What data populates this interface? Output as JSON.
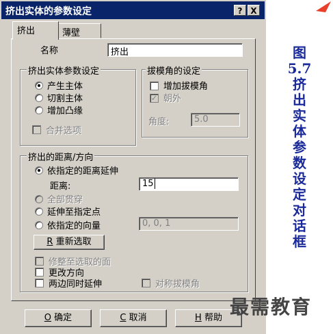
{
  "dialog": {
    "title": "挤出实体的参数设定",
    "help_button": "?",
    "close_button": "X",
    "tabs": [
      {
        "label": "挤出"
      },
      {
        "label": "薄壁"
      }
    ],
    "name_label": "名称",
    "name_value": "挤出",
    "group_params": {
      "title": "挤出实体参数设定",
      "radios": [
        {
          "label": "产生主体",
          "checked": true
        },
        {
          "label": "切割主体",
          "checked": false
        },
        {
          "label": "增加凸缘",
          "checked": false
        }
      ],
      "merge_checkbox": "合并选项"
    },
    "group_draft": {
      "title": "拔模角的设定",
      "add_draft": "增加拔模角",
      "outward": "朝外",
      "angle_label": "角度:",
      "angle_value": "5.0"
    },
    "group_distance": {
      "title": "挤出的距离/方向",
      "by_distance": "依指定的距离延伸",
      "distance_label": "距离:",
      "distance_value": "15",
      "through_all": "全部贯穿",
      "to_point": "延伸至指定点",
      "by_vector": "依指定的向量",
      "vector_value": "0, 0, 1",
      "reselect_key": "R",
      "reselect_label": "重新选取",
      "trim_face": "修整至选取的面",
      "change_direction": "更改方向",
      "both_sides": "两边同时延伸",
      "symmetric_draft": "对称拔模角"
    },
    "buttons": {
      "ok_key": "O",
      "ok_label": "确定",
      "cancel_key": "C",
      "cancel_label": "取消",
      "help_key": "H",
      "help_label": "帮助"
    }
  },
  "caption": "图5.7 挤出实体参数设定对话框",
  "watermark": "最需教育",
  "colors": {
    "title_bar": "#0a246a",
    "dialog_bg": "#d4d0c8",
    "caption": "#1a2a9a"
  }
}
